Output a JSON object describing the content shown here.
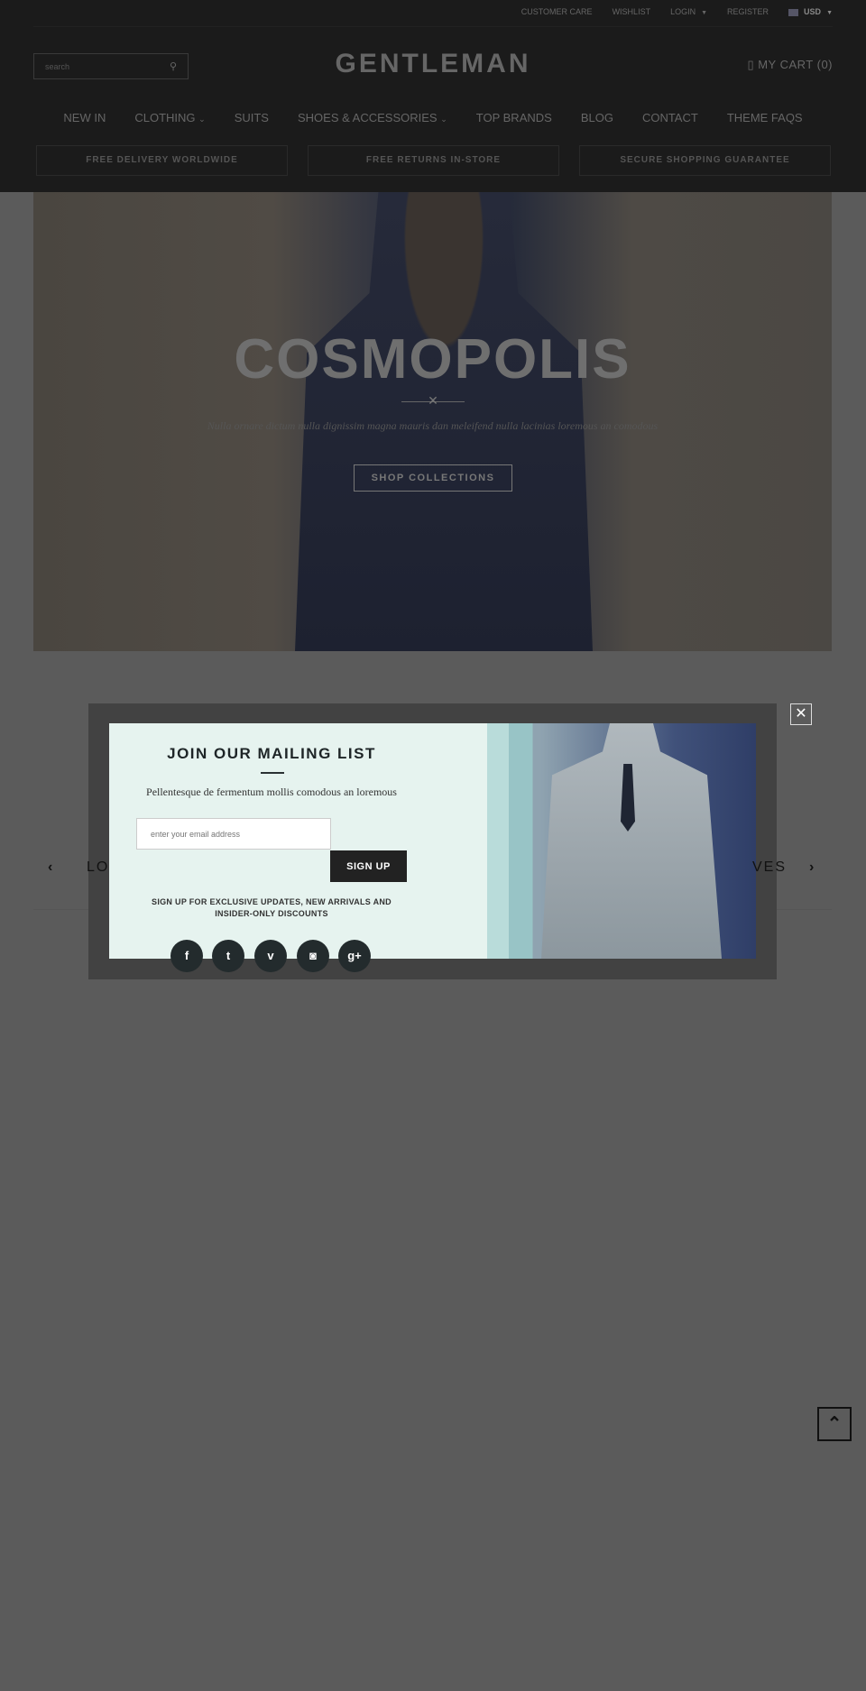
{
  "topbar": {
    "customer_care": "CUSTOMER CARE",
    "wishlist": "WISHLIST",
    "login": "LOGIN",
    "register": "REGISTER",
    "currency": "USD"
  },
  "header": {
    "search_placeholder": "search",
    "logo": "GENTLEMAN",
    "cart": "MY CART (0)"
  },
  "nav": [
    "NEW IN",
    "CLOTHING",
    "SUITS",
    "SHOES & ACCESSORIES",
    "TOP BRANDS",
    "BLOG",
    "CONTACT",
    "THEME FAQS"
  ],
  "features": [
    "FREE DELIVERY WORLDWIDE",
    "FREE RETURNS IN-STORE",
    "SECURE SHOPPING GUARANTEE"
  ],
  "hero": {
    "title": "COSMOPOLIS",
    "subtitle": "Nulla ornare dictum nulla dignissim magna mauris dan meleifend nulla lacinias loremous an comodous",
    "button": "SHOP COLLECTIONS"
  },
  "carousel": {
    "left_text": "LO",
    "right_text": "VES"
  },
  "popup": {
    "title": "JOIN OUR MAILING LIST",
    "text": "Pellentesque de fermentum mollis comodous an loremous",
    "email_placeholder": "enter your email address",
    "signup": "SIGN UP",
    "note": "SIGN UP FOR EXCLUSIVE UPDATES, NEW ARRIVALS AND INSIDER-ONLY DISCOUNTS",
    "social": [
      "facebook",
      "twitter",
      "vimeo",
      "instagram",
      "google-plus"
    ]
  }
}
